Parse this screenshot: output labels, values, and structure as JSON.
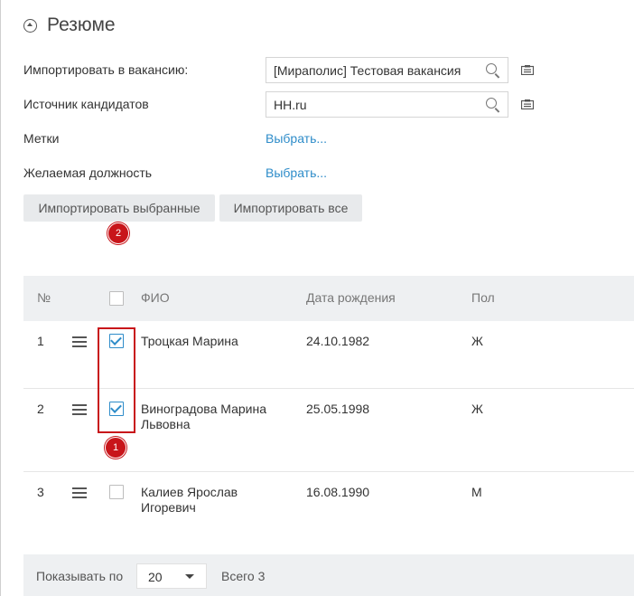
{
  "section": {
    "title": "Резюме",
    "collapse_icon": "collapse-icon"
  },
  "form": {
    "vacancy": {
      "label": "Импортировать в вакансию:",
      "value": "[Мираполис] Тестовая вакансия"
    },
    "source": {
      "label": "Источник кандидатов",
      "value": "HH.ru"
    },
    "tags": {
      "label": "Метки",
      "link": "Выбрать..."
    },
    "position": {
      "label": "Желаемая должность",
      "link": "Выбрать..."
    }
  },
  "buttons": {
    "import_selected": "Импортировать выбранные",
    "import_all": "Импортировать все"
  },
  "markers": {
    "m1": "1",
    "m2": "2",
    "color": "#c8151a"
  },
  "table": {
    "headers": {
      "num": "№",
      "name": "ФИО",
      "birth": "Дата рождения",
      "gender": "Пол"
    },
    "rows": [
      {
        "num": "1",
        "name": "Троцкая Марина",
        "birth": "24.10.1982",
        "gender": "Ж",
        "checked": true
      },
      {
        "num": "2",
        "name": "Виноградова Марина Львовна",
        "birth": "25.05.1998",
        "gender": "Ж",
        "checked": true
      },
      {
        "num": "3",
        "name": "Калиев Ярослав Игоревич",
        "birth": "16.08.1990",
        "gender": "М",
        "checked": false
      }
    ]
  },
  "pager": {
    "label": "Показывать по",
    "page_size": "20",
    "total": "Всего 3"
  },
  "colors": {
    "accent": "#2e8cc9",
    "header_bg": "#eef0f2",
    "annotation": "#c8151a"
  }
}
